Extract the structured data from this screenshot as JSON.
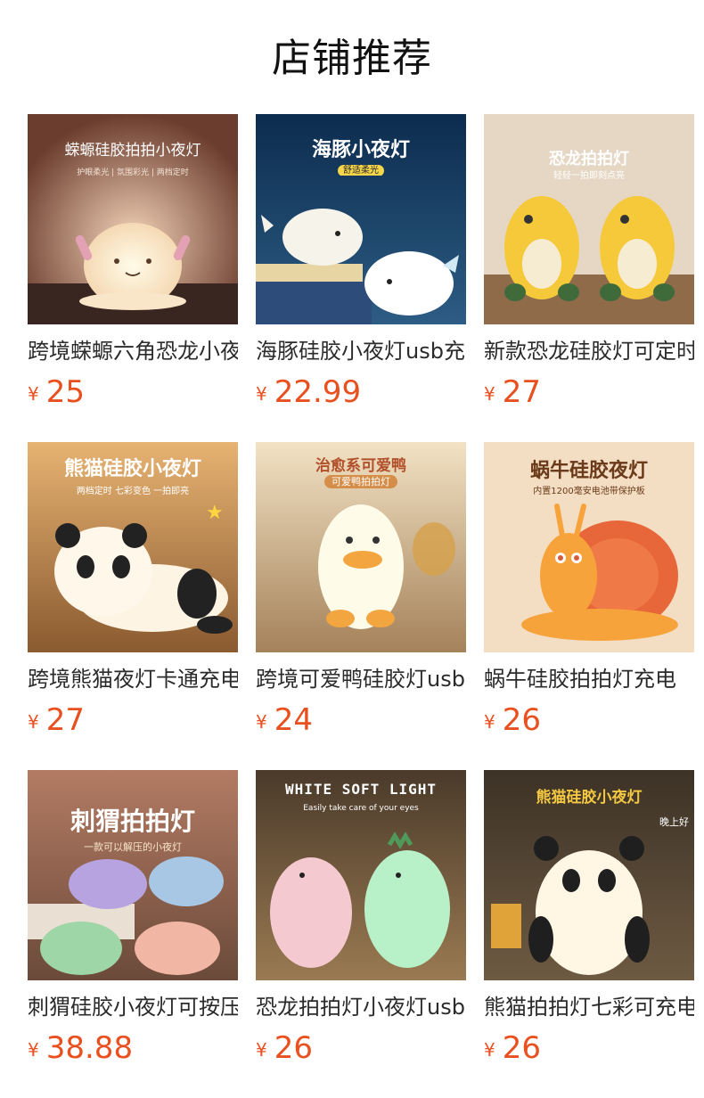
{
  "page_title": "店铺推荐",
  "currency_symbol": "¥",
  "colors": {
    "price": "#e8501f",
    "title": "#111111"
  },
  "products": [
    {
      "name": "跨境蝾螈六角恐龙小夜灯",
      "price": "25",
      "image_icon": "axolotl-lamp-icon",
      "thumb_title": "蝾螈硅胶拍拍小夜灯",
      "thumb_sub": "护眼柔光 | 氛围彩光 | 两档定时"
    },
    {
      "name": "海豚硅胶小夜灯usb充电",
      "price": "22.99",
      "image_icon": "whale-lamp-icon",
      "thumb_title": "海豚小夜灯",
      "thumb_sub": "舒适柔光"
    },
    {
      "name": "新款恐龙硅胶灯可定时",
      "price": "27",
      "image_icon": "dinosaur-lamp-icon",
      "thumb_title": "恐龙拍拍灯",
      "thumb_sub": "轻轻一拍即刻点亮"
    },
    {
      "name": "跨境熊猫夜灯卡通充电",
      "price": "27",
      "image_icon": "panda-lamp-icon",
      "thumb_title": "熊猫硅胶小夜灯",
      "thumb_sub": "两档定时 七彩变色 一拍即亮"
    },
    {
      "name": "跨境可爱鸭硅胶灯usb",
      "price": "24",
      "image_icon": "duck-lamp-icon",
      "thumb_title": "治愈系可爱鸭",
      "thumb_sub": "可爱鸭拍拍灯"
    },
    {
      "name": "蜗牛硅胶拍拍灯充电",
      "price": "26",
      "image_icon": "snail-lamp-icon",
      "thumb_title": "蜗牛硅胶夜灯",
      "thumb_sub": "内置1200毫安电池带保护板"
    },
    {
      "name": "刺猬硅胶小夜灯可按压",
      "price": "38.88",
      "image_icon": "hedgehog-lamp-icon",
      "thumb_title": "刺猬拍拍灯",
      "thumb_sub": "一款可以解压的小夜灯"
    },
    {
      "name": "恐龙拍拍灯小夜灯usb",
      "price": "26",
      "image_icon": "dinosaur-pair-lamp-icon",
      "thumb_title": "WHITE SOFT LIGHT",
      "thumb_sub": "Easily take care of your eyes"
    },
    {
      "name": "熊猫拍拍灯七彩可充电",
      "price": "26",
      "image_icon": "panda-sitting-lamp-icon",
      "thumb_title": "熊猫硅胶小夜灯",
      "thumb_sub": "晚上好"
    }
  ]
}
